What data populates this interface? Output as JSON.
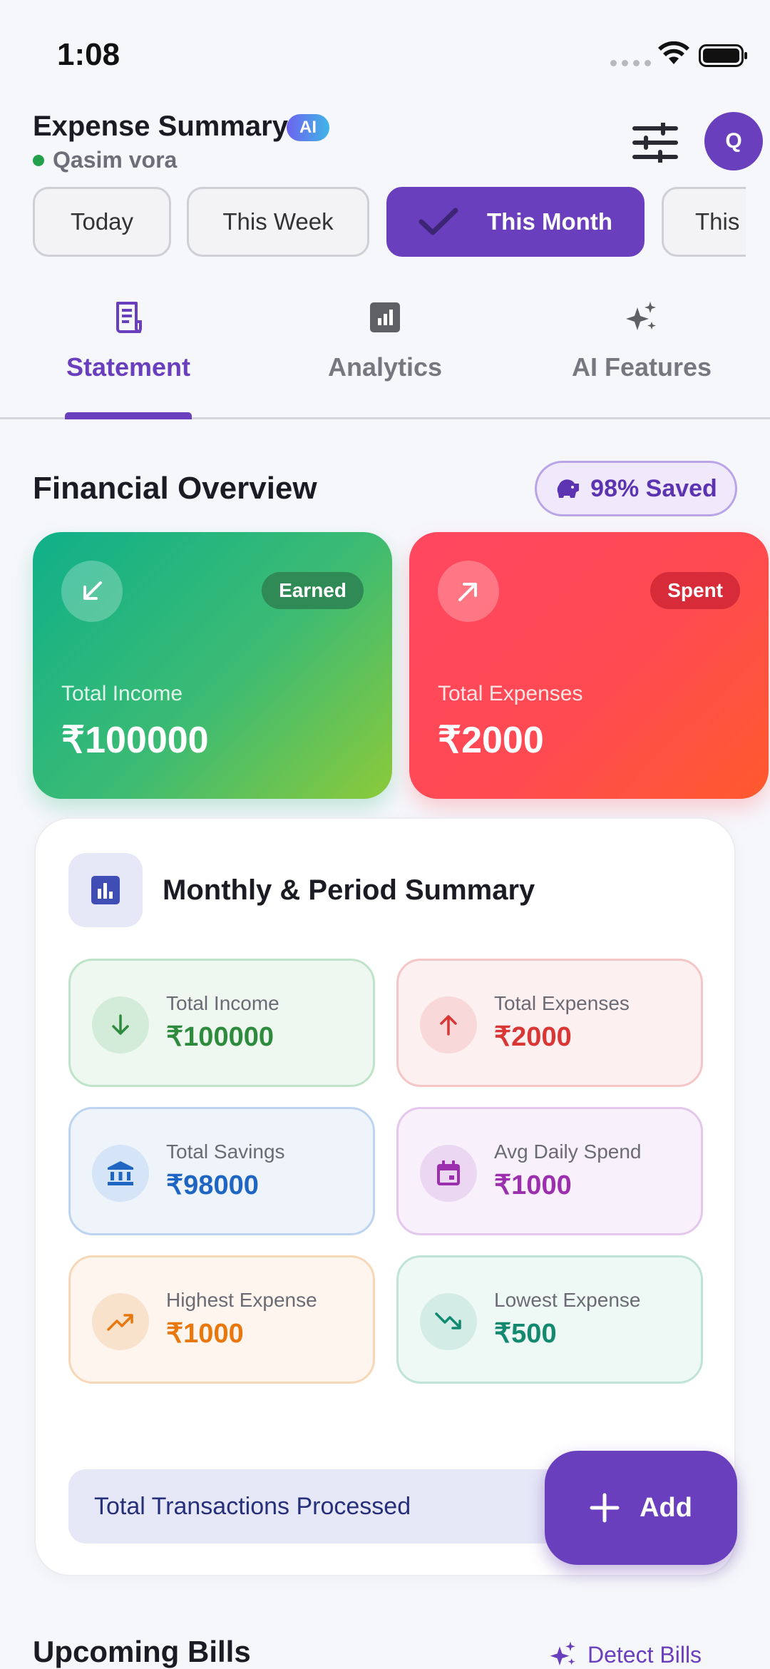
{
  "status_bar": {
    "time": "1:08"
  },
  "header": {
    "title": "Expense Summary",
    "ai_badge": "AI",
    "user_name": "Qasim vora",
    "avatar_initial": "Q"
  },
  "period_chips": [
    {
      "label": "Today",
      "active": false
    },
    {
      "label": "This Week",
      "active": false
    },
    {
      "label": "This Month",
      "active": true
    },
    {
      "label": "This",
      "active": false
    }
  ],
  "tabs": [
    {
      "label": "Statement",
      "icon": "receipt-icon",
      "active": true
    },
    {
      "label": "Analytics",
      "icon": "bar-chart-icon",
      "active": false
    },
    {
      "label": "AI Features",
      "icon": "sparkle-icon",
      "active": false
    }
  ],
  "financial_overview": {
    "title": "Financial Overview",
    "saved_pill": "98% Saved",
    "income_card": {
      "tag": "Earned",
      "label": "Total Income",
      "amount": "₹100000"
    },
    "expense_card": {
      "tag": "Spent",
      "label": "Total Expenses",
      "amount": "₹2000"
    }
  },
  "summary": {
    "title": "Monthly & Period Summary",
    "stats": {
      "total_income": {
        "label": "Total Income",
        "value": "₹100000"
      },
      "total_expenses": {
        "label": "Total Expenses",
        "value": "₹2000"
      },
      "total_savings": {
        "label": "Total Savings",
        "value": "₹98000"
      },
      "avg_daily_spend": {
        "label": "Avg Daily Spend",
        "value": "₹1000"
      },
      "highest_expense": {
        "label": "Highest Expense",
        "value": "₹1000"
      },
      "lowest_expense": {
        "label": "Lowest Expense",
        "value": "₹500"
      }
    },
    "transactions_label": "Total Transactions Processed"
  },
  "fab": {
    "label": "Add"
  },
  "upcoming_bills": {
    "title": "Upcoming Bills",
    "detect_label": "Detect Bills"
  },
  "colors": {
    "accent": "#6a3fbd",
    "income_green": "#2e8b3e",
    "expense_red": "#d93636"
  }
}
